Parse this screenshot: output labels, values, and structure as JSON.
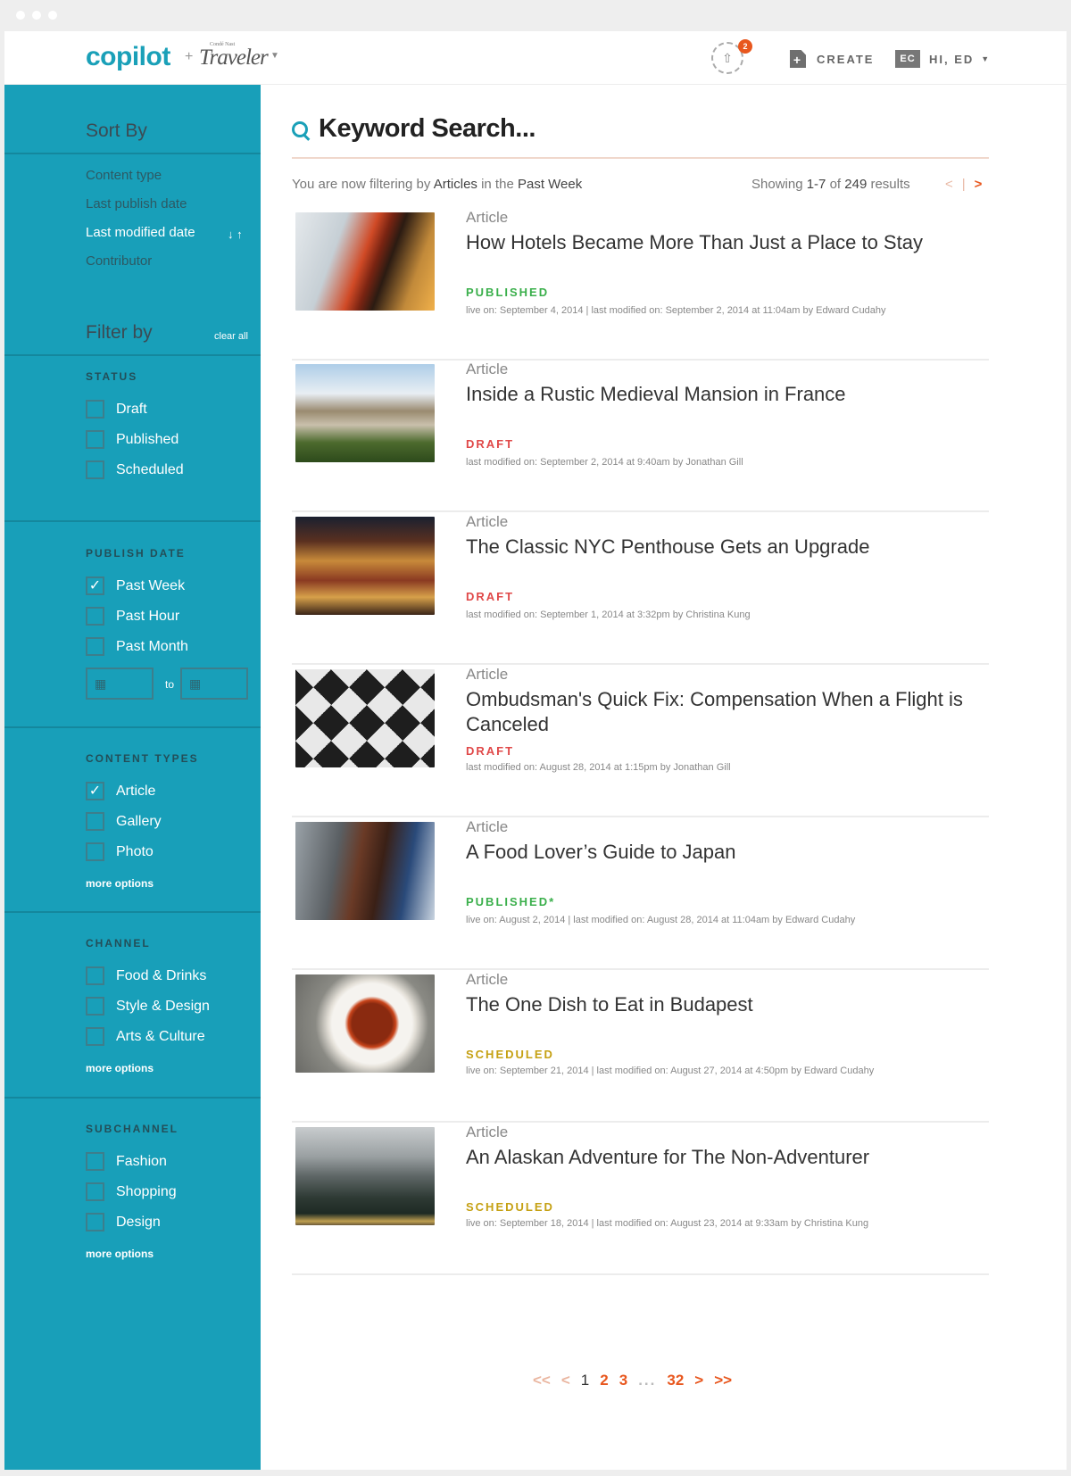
{
  "header": {
    "logo": "copilot",
    "plus": "+",
    "brand": "Traveler",
    "brand_small": "Condé Nast",
    "upload_badge": "2",
    "create_label": "CREATE",
    "avatar_initials": "EC",
    "greeting": "HI, ED"
  },
  "sidebar": {
    "sort_heading": "Sort By",
    "sort_items": [
      "Content type",
      "Last publish date",
      "Last modified date",
      "Contributor"
    ],
    "sort_arrows": "↓ ↑",
    "filter_heading": "Filter by",
    "clear_all": "clear all",
    "status": {
      "title": "STATUS",
      "options": [
        "Draft",
        "Published",
        "Scheduled"
      ]
    },
    "publish_date": {
      "title": "PUBLISH DATE",
      "options": [
        "Past Week",
        "Past Hour",
        "Past Month"
      ],
      "to": "to"
    },
    "content_types": {
      "title": "CONTENT TYPES",
      "options": [
        "Article",
        "Gallery",
        "Photo"
      ],
      "more": "more options"
    },
    "channel": {
      "title": "CHANNEL",
      "options": [
        "Food & Drinks",
        "Style & Design",
        "Arts & Culture"
      ],
      "more": "more options"
    },
    "subchannel": {
      "title": "SUBCHANNEL",
      "options": [
        "Fashion",
        "Shopping",
        "Design"
      ],
      "more": "more options"
    }
  },
  "main": {
    "search_placeholder": "Keyword Search...",
    "filter_prefix": "You are now filtering by",
    "filter_type": "Articles",
    "filter_mid": "in the",
    "filter_range": "Past Week",
    "showing_prefix": "Showing",
    "showing_range": "1-7",
    "showing_of": "of",
    "showing_total": "249",
    "showing_suffix": "results",
    "prev": "<",
    "sep": "|",
    "next": ">",
    "results": [
      {
        "type": "Article",
        "title": "How Hotels Became More Than Just a Place to Stay",
        "status": "PUBLISHED",
        "meta": "live on: September 4, 2014   |   last modified on: September 2, 2014 at 11:04am by Edward Cudahy"
      },
      {
        "type": "Article",
        "title": "Inside a Rustic Medieval Mansion in France",
        "status": "DRAFT",
        "meta": "last modified on: September 2, 2014 at 9:40am by Jonathan Gill"
      },
      {
        "type": "Article",
        "title": "The Classic NYC Penthouse Gets an Upgrade",
        "status": "DRAFT",
        "meta": "last modified on: September 1, 2014 at 3:32pm by Christina Kung"
      },
      {
        "type": "Article",
        "title": "Ombudsman's Quick Fix: Compensation When a Flight is Canceled",
        "status": "DRAFT",
        "meta": "last modified on: August 28, 2014 at 1:15pm by Jonathan Gill"
      },
      {
        "type": "Article",
        "title": "A Food Lover’s Guide to Japan",
        "status": "PUBLISHED*",
        "meta": "live on: August 2, 2014   |   last modified on: August 28, 2014 at 11:04am by Edward Cudahy"
      },
      {
        "type": "Article",
        "title": "The One Dish to Eat in Budapest",
        "status": "SCHEDULED",
        "meta": "live on: September 21, 2014   |   last modified on: August 27, 2014 at 4:50pm by Edward Cudahy"
      },
      {
        "type": "Article",
        "title": "An Alaskan Adventure for The Non-Adventurer",
        "status": "SCHEDULED",
        "meta": "live on: September 18, 2014  |  last modified on: August 23, 2014 at 9:33am by Christina Kung"
      }
    ],
    "pagination": {
      "first": "<<",
      "prev": "<",
      "pages": [
        "1",
        "2",
        "3"
      ],
      "ellipsis": "...",
      "last_page": "32",
      "next": ">",
      "last": ">>"
    }
  },
  "colors": {
    "accent": "#1aa0b8",
    "sidebar": "#189fb9",
    "orange": "#e8571e",
    "published": "#3aaf4b",
    "draft": "#e04848",
    "scheduled": "#c5a012"
  }
}
